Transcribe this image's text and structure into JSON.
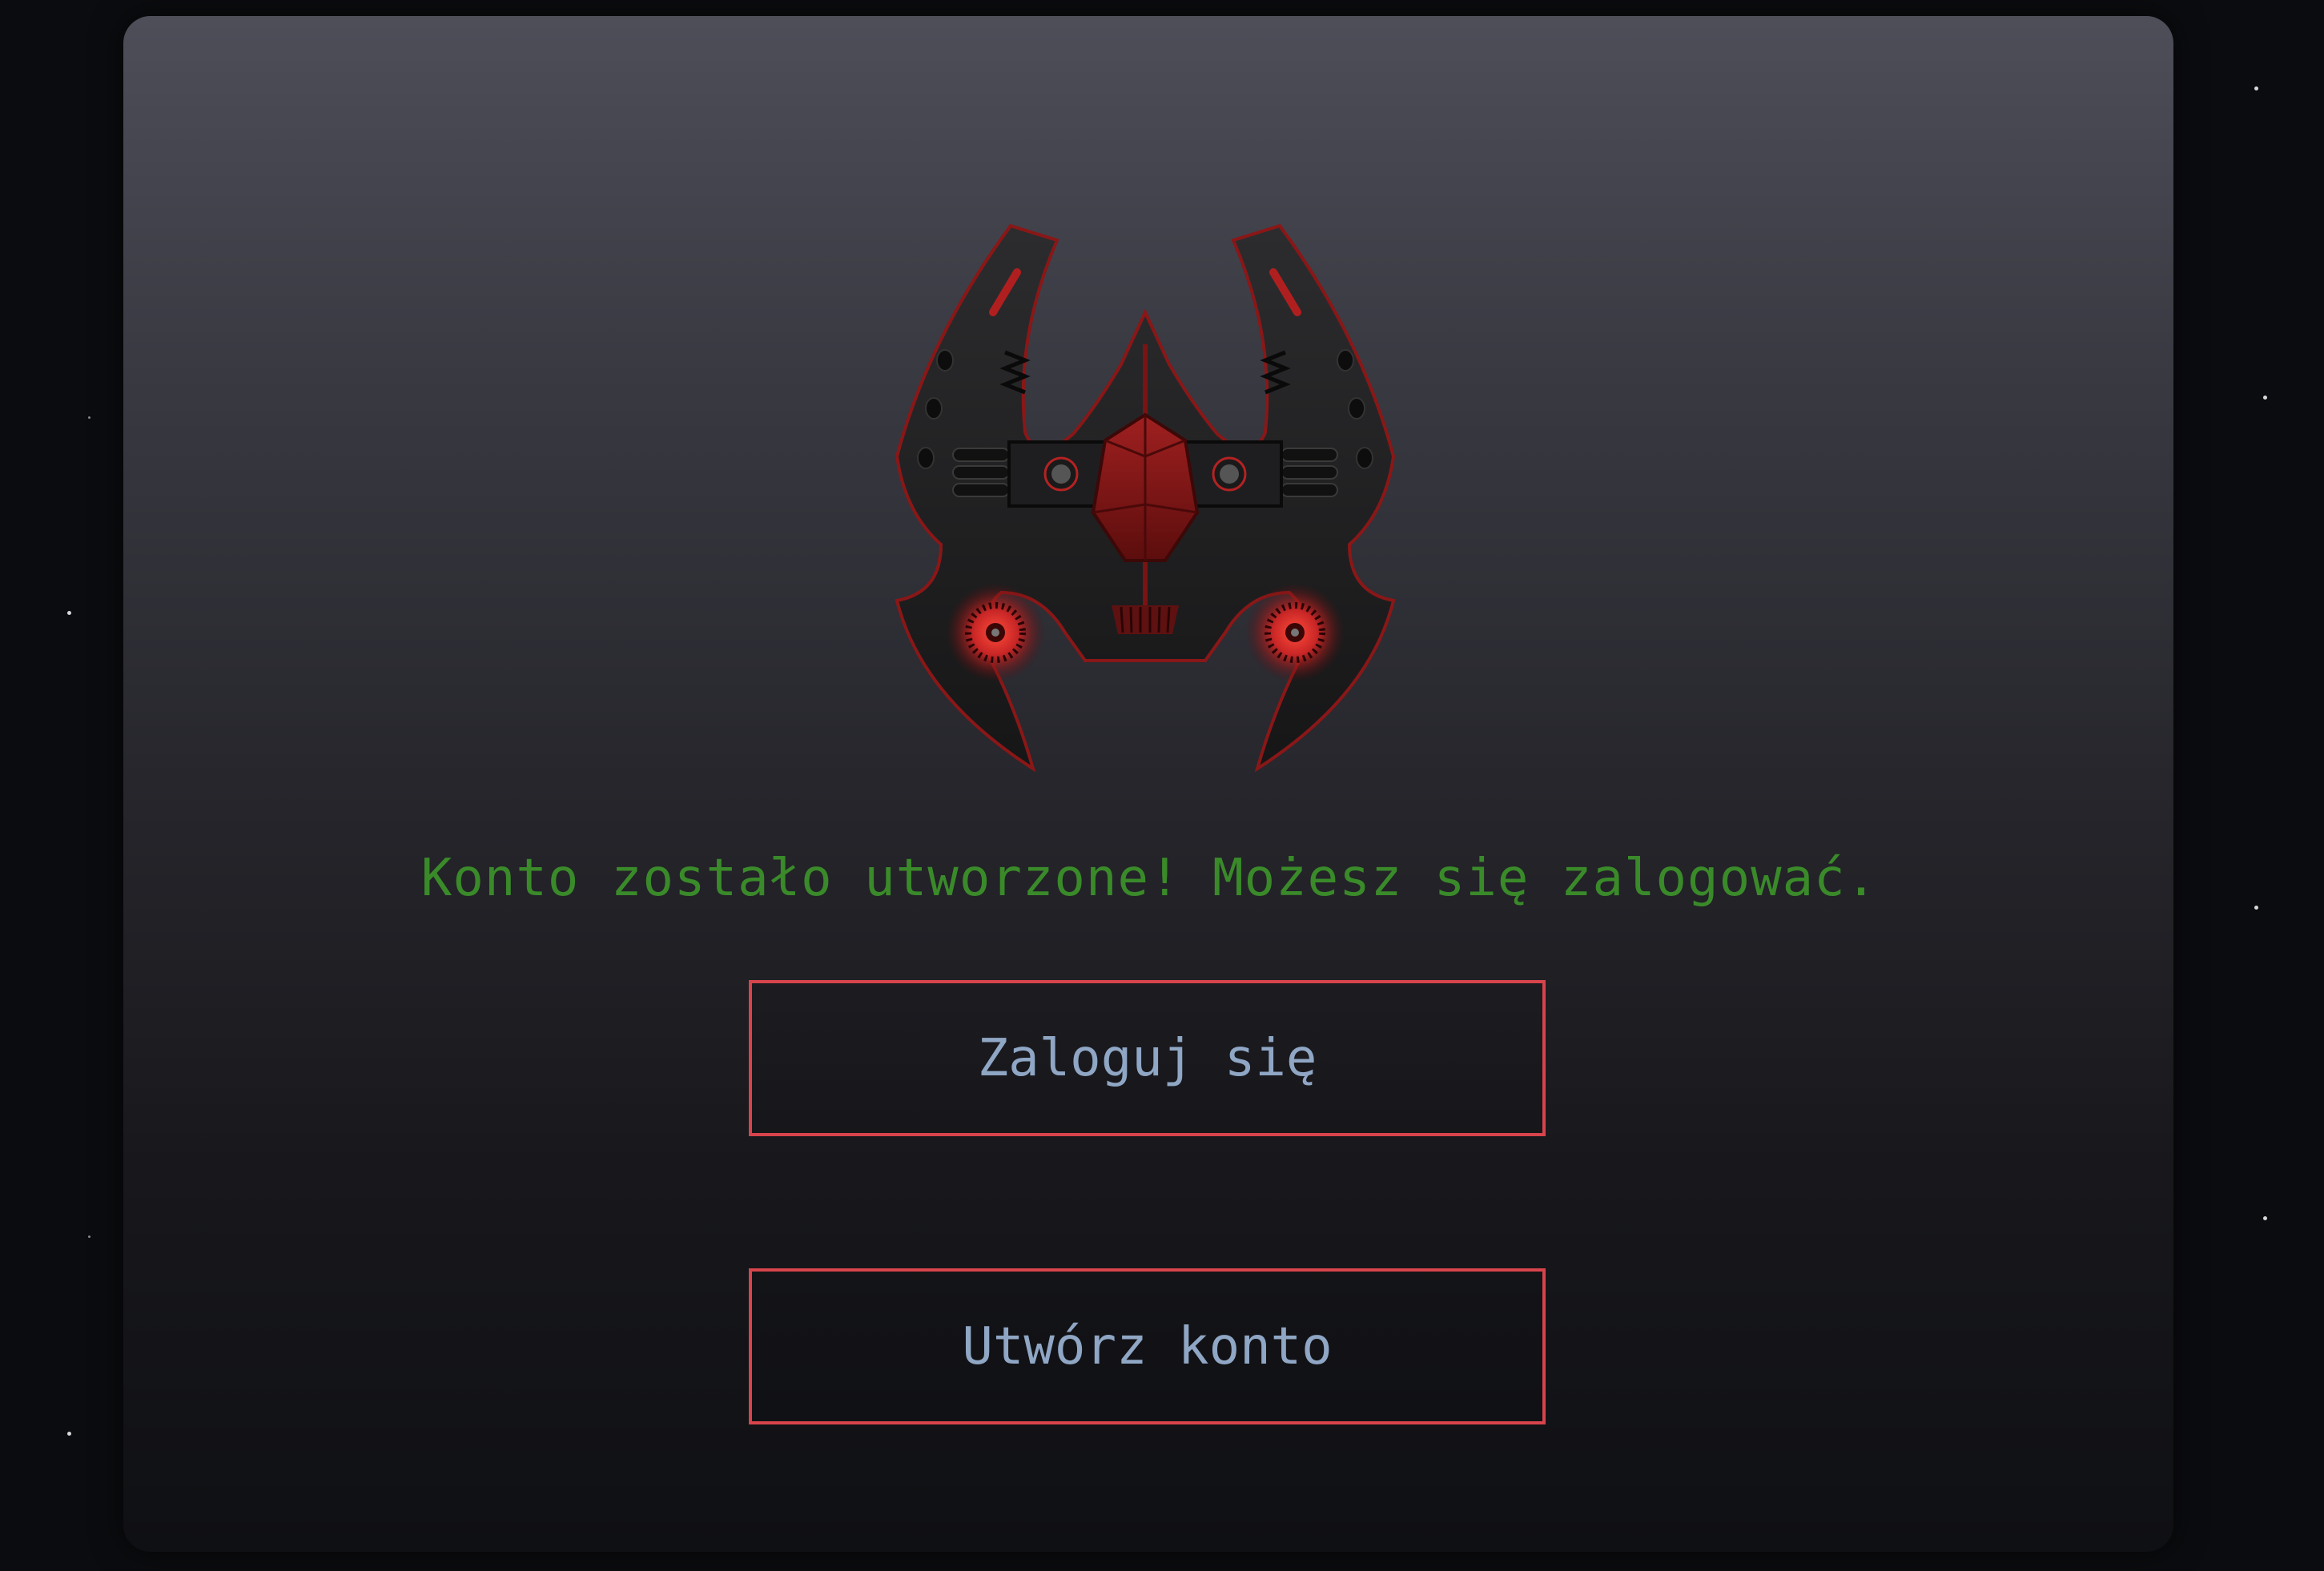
{
  "auth_screen": {
    "status_message": "Konto zostało utworzone! Możesz się zalogować.",
    "login_button_label": "Zaloguj się",
    "register_button_label": "Utwórz konto"
  },
  "colors": {
    "success_text": "#3a8a2a",
    "button_border": "#d8444c",
    "button_text": "#8fa6c4",
    "ship_accent": "#b52222"
  },
  "logo": {
    "icon": "spaceship-logo-icon"
  }
}
